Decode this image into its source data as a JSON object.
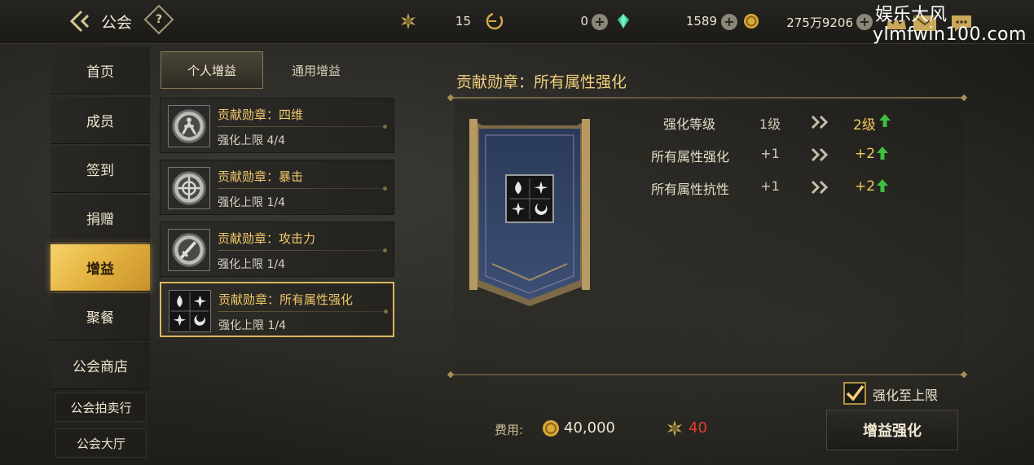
{
  "header": {
    "title": "公会",
    "help_glyph": "?",
    "back_icon": "back-arrow-icon",
    "resources": [
      {
        "icon": "medal-icon",
        "value": "15"
      },
      {
        "icon": "currency-c-icon",
        "value": "0"
      },
      {
        "icon": "gem-icon",
        "value": "1589"
      },
      {
        "icon": "gold-coin-icon",
        "value": "275万9206"
      }
    ],
    "plus_glyph": "+"
  },
  "watermark": {
    "brand": "娱乐大风",
    "url": "ylmfwin100.com"
  },
  "sidebar": {
    "items": [
      {
        "label": "首页",
        "active": false
      },
      {
        "label": "成员",
        "active": false
      },
      {
        "label": "签到",
        "active": false
      },
      {
        "label": "捐赠",
        "active": false
      },
      {
        "label": "增益",
        "active": true
      },
      {
        "label": "聚餐",
        "active": false
      },
      {
        "label": "公会商店",
        "active": false
      }
    ],
    "small_items": [
      {
        "label": "公会拍卖行"
      },
      {
        "label": "公会大厅"
      }
    ]
  },
  "tabs": [
    {
      "label": "个人增益",
      "active": true
    },
    {
      "label": "通用增益",
      "active": false
    }
  ],
  "buffs": [
    {
      "name": "贡献勋章：四维",
      "limit": "强化上限 4/4",
      "icon": "four-dimension-icon",
      "selected": false
    },
    {
      "name": "贡献勋章：暴击",
      "limit": "强化上限 1/4",
      "icon": "critical-icon",
      "selected": false
    },
    {
      "name": "贡献勋章：攻击力",
      "limit": "强化上限 1/4",
      "icon": "attack-sword-icon",
      "selected": false
    },
    {
      "name": "贡献勋章：所有属性强化",
      "limit": "强化上限 1/4",
      "icon": "elements-icon",
      "selected": true
    }
  ],
  "detail": {
    "title": "贡献勋章：所有属性强化",
    "stats": [
      {
        "label": "强化等级",
        "current": "1级",
        "next": "2级"
      },
      {
        "label": "所有属性强化",
        "current": "+1",
        "next": "+2"
      },
      {
        "label": "所有属性抗性",
        "current": "+1",
        "next": "+2"
      }
    ]
  },
  "footer": {
    "max_checkbox_label": "强化至上限",
    "max_checked": true,
    "cost_label": "费用:",
    "cost_gold": "40,000",
    "cost_medal": "40",
    "upgrade_button": "增益强化"
  },
  "colors": {
    "accent_gold": "#f0c96a",
    "active_nav": "#e3b13e",
    "upgrade_arrow": "#3fbf3f",
    "insufficient": "#e53e2e"
  }
}
